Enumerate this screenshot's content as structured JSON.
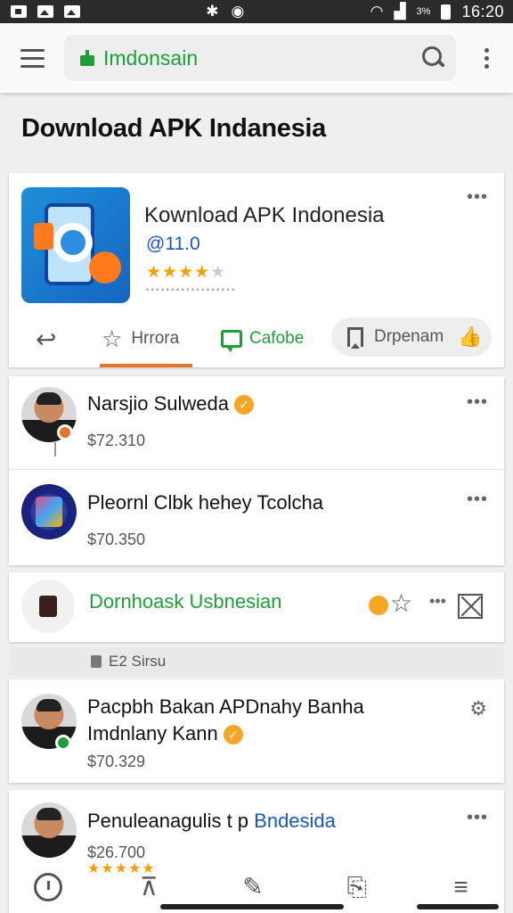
{
  "status_bar": {
    "time": "16:20",
    "battery_text": "3%"
  },
  "app_bar": {
    "search_text": "Imdonsain"
  },
  "page": {
    "title": "Download APK Indanesia"
  },
  "featured": {
    "title": "Kownload APK Indonesia",
    "version": "@11.0",
    "rating_stars": 4,
    "subtitle": "• • • • • • • • • • • • • • • • • •",
    "actions": {
      "fav_label": "Hrrora",
      "chat_label": "Cafobe",
      "download_label": "Drpenam"
    }
  },
  "list": [
    {
      "title": "Narsjio Sulweda",
      "price": "$72.310",
      "verified": true
    },
    {
      "title": "Pleornl Clbk hehey Tcolcha",
      "price": "$70.350",
      "verified": false
    }
  ],
  "promo": {
    "title": "Dornhoask Usbnesian"
  },
  "section_label": {
    "text": "E2 Sirsu"
  },
  "card3": {
    "title_line1": "Pacpbh Bakan APDnahy Banha",
    "title_line2": "Imdnlany Kann",
    "price": "$70.329"
  },
  "card4": {
    "title_main": "Penuleanagulis t p",
    "title_accent": "Bndesida",
    "price": "$26.700"
  },
  "colors": {
    "accent_green": "#1e9e3a",
    "accent_orange": "#e8742a",
    "star_gold": "#f5a000",
    "link_blue": "#1a56c2"
  }
}
